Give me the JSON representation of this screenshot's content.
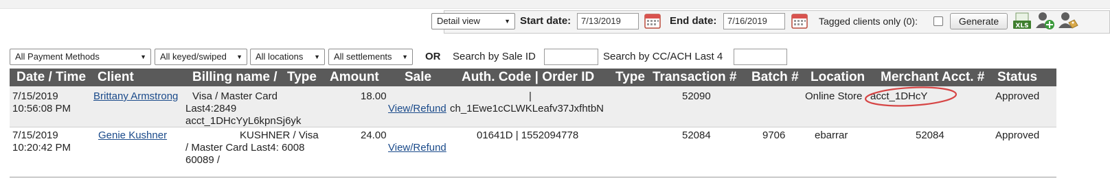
{
  "toolbar": {
    "view_select": "Detail view",
    "start_label": "Start date:",
    "start_value": "7/13/2019",
    "end_label": "End date:",
    "end_value": "7/16/2019",
    "tagged_label": "Tagged clients only (0):",
    "generate_label": "Generate",
    "icons": [
      "calendar-icon",
      "xls-export-icon",
      "add-user-icon",
      "tag-user-icon"
    ]
  },
  "filters": {
    "payment_methods": "All Payment Methods",
    "keyed": "All keyed/swiped",
    "locations": "All locations",
    "settlements": "All settlements",
    "or_label": "OR",
    "sale_id_label": "Search by Sale ID",
    "cc_label": "Search by CC/ACH Last 4"
  },
  "table": {
    "headers": [
      "Date / Time",
      "Client",
      "Billing name /",
      "Type",
      "Amount",
      "Sale",
      "Auth. Code | Order ID",
      "Type",
      "Transaction #",
      "Batch #",
      "Location",
      "Merchant Acct. #",
      "Status"
    ],
    "rows": [
      {
        "date": "7/15/2019",
        "time": "10:56:08 PM",
        "client": "Brittany Armstrong",
        "billing_1": "Visa / Master Card",
        "billing_2": "Last4:2849",
        "billing_3": "acct_1DHcYyL6kpnSj6yk",
        "amount": "18.00",
        "sale": "View/Refund",
        "auth_1": "|",
        "auth_2": "ch_1Ewe1cCLWKLeafv37JxfhtbN",
        "transaction": "52090",
        "batch": "",
        "location": "Online Store",
        "merchant": "acct_1DHcY",
        "status": "Approved"
      },
      {
        "date": "7/15/2019",
        "time": "10:20:42 PM",
        "client": "Genie Kushner",
        "billing_1": "KUSHNER / Visa",
        "billing_2": "/ Master Card Last4: 6008",
        "billing_3": "60089 /",
        "amount": "24.00",
        "sale": "View/Refund",
        "auth_1": "01641D | 1552094778",
        "transaction": "52084",
        "batch": "9706",
        "location": "ebarrar",
        "merchant": "52084",
        "status": "Approved"
      }
    ]
  }
}
